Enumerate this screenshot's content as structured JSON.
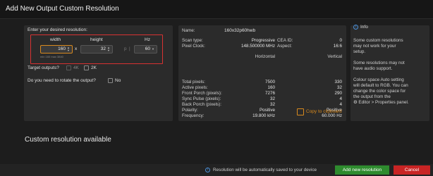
{
  "window": {
    "title": "Add New Output Custom Resolution"
  },
  "left": {
    "prompt": "Enter your desired resolution:",
    "width_label": "width",
    "height_label": "height",
    "hz_label": "Hz",
    "width_value": "160",
    "height_value": "32",
    "p_label": "p",
    "hz_value": "60",
    "x_sep": "x",
    "minmax": "min 160  max 3840",
    "target_label": "Target outputs?",
    "opt_4k": "4K",
    "opt_2k": "2K",
    "rotate_label": "Do you need to rotate the output?",
    "opt_no": "No"
  },
  "middle": {
    "name_label": "Name:",
    "name_value": "160x32p60hwb",
    "scan_label": "Scan type:",
    "scan_value": "Progressive",
    "clock_label": "Pixel Clock:",
    "clock_value": "148.500000 MHz",
    "cea_label": "CEA ID:",
    "cea_value": "0",
    "aspect_label": "Aspect:",
    "aspect_value": "16:6",
    "col_h": "Horizontal",
    "col_v": "Vertical",
    "rows": [
      {
        "label": "Total pixels:",
        "h": "7500",
        "v": "330"
      },
      {
        "label": "Active pixels:",
        "h": "160",
        "v": "32"
      },
      {
        "label": "Front Porch (pixels):",
        "h": "7276",
        "v": "290"
      },
      {
        "label": "Sync Pulse (pixels):",
        "h": "32",
        "v": "4"
      },
      {
        "label": "Back Porch (pixels):",
        "h": "32",
        "v": "4"
      },
      {
        "label": "Polarity:",
        "h": "Positive",
        "v": "Positive"
      },
      {
        "label": "Frequency:",
        "h": "19.800 kHz",
        "v": "60.000 Hz"
      }
    ],
    "copy_label": "Copy to clipboard"
  },
  "info": {
    "heading": "Info",
    "p1a": "Some custom resolutions",
    "p1b": "may not work for your",
    "p1c": "setup.",
    "p2a": "Some resolutions may not",
    "p2b": "have audio support.",
    "p3a": "Colour space Auto setting",
    "p3b": "will default to RGB. You can",
    "p3c": "change the color space for",
    "p3d": "the output from the",
    "p3e": "Editor > Properties panel."
  },
  "custom_available": "Custom resolution available",
  "footer": {
    "note": "Resolution will be automatically saved to your device",
    "add_label": "Add new resolution",
    "cancel_label": "Cancel"
  },
  "colors": {
    "accent": "#d98a1e",
    "ok": "#2e8b2e",
    "danger": "#c82424",
    "highlight": "#d83232",
    "info": "#4a90d9"
  }
}
